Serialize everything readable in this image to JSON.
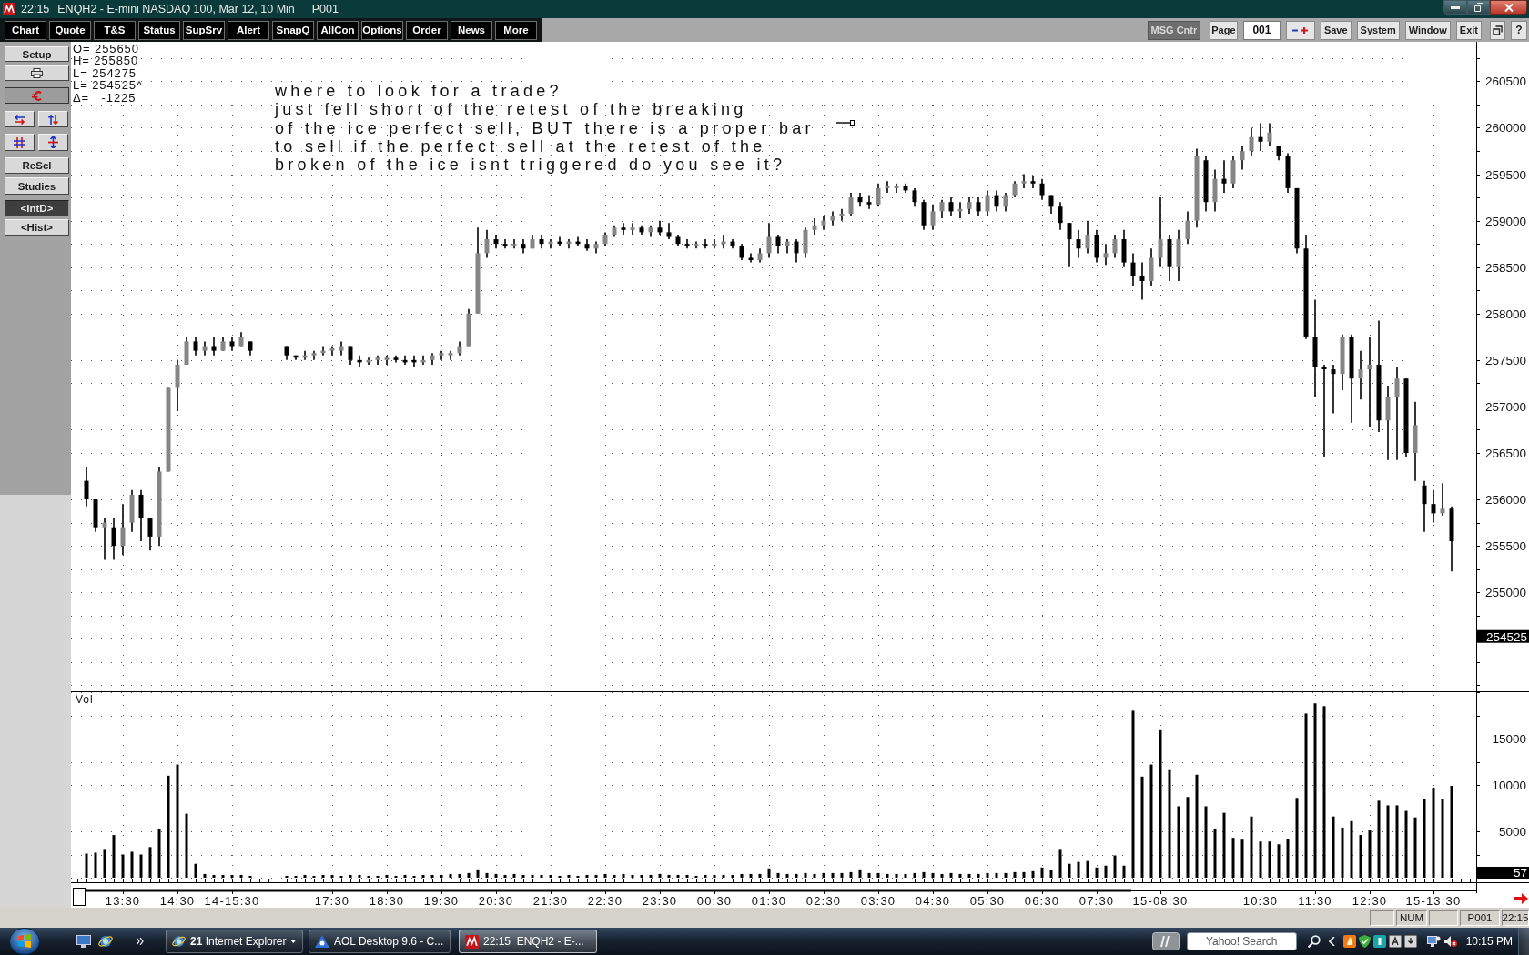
{
  "window": {
    "time": "22:15",
    "title": "ENQH2 - E-mini NASDAQ 100, Mar 12, 10 Min",
    "page": "P001"
  },
  "toolbar": {
    "buttons": [
      "Chart",
      "Quote",
      "T&S",
      "Status",
      "SupSrv",
      "Alert",
      "SnapQ",
      "AllCon",
      "Options",
      "Order",
      "News",
      "More"
    ],
    "message_center": "MSG Cntr",
    "page_label": "Page",
    "page_value": "001",
    "actions": [
      "Save",
      "System",
      "Window",
      "Exit"
    ],
    "help": "?"
  },
  "sidebar": {
    "setup": "Setup",
    "buttons": [
      "ReScl",
      "Studies"
    ],
    "modes": [
      {
        "label": "<IntD>",
        "selected": true
      },
      {
        "label": "<Hist>",
        "selected": false
      }
    ]
  },
  "chart": {
    "readout": [
      "O= 255650",
      "H= 255850",
      "L= 254275",
      "L= 254525^",
      "Δ=   -1225"
    ],
    "note": [
      "where to look for a trade?",
      "just fell short of the retest of the breaking",
      "of the ice perfect sell, BUT there is a proper bar",
      "to sell if the perfect sell at the retest of the",
      "broken of the ice isnt triggered do you see it?"
    ],
    "last_price": "254525",
    "last_volume": "57",
    "chart_data": [
      {
        "type": "candlestick",
        "tick_labels": "y",
        "grid": true,
        "ylim": [
          253925,
          260925
        ],
        "yticks": [
          255000,
          255500,
          256000,
          256500,
          257000,
          257500,
          258000,
          258500,
          259000,
          259500,
          260000,
          260500
        ],
        "ohlc": [
          [
            256200,
            256350,
            255925,
            256000
          ],
          [
            256000,
            256000,
            255650,
            255700
          ],
          [
            255700,
            255800,
            255350,
            255750
          ],
          [
            255700,
            255800,
            255350,
            255500
          ],
          [
            255500,
            255950,
            255400,
            255700
          ],
          [
            255750,
            256100,
            255650,
            256050
          ],
          [
            256050,
            256100,
            255550,
            255800
          ],
          [
            255800,
            255800,
            255450,
            255600
          ],
          [
            255600,
            256350,
            255500,
            256300
          ],
          [
            256300,
            257200,
            256300,
            257200
          ],
          [
            257200,
            257500,
            256950,
            257450
          ],
          [
            257450,
            257750,
            257450,
            257700
          ],
          [
            257700,
            257750,
            257550,
            257600
          ],
          [
            257600,
            257700,
            257550,
            257650
          ],
          [
            257650,
            257750,
            257550,
            257600
          ],
          [
            257600,
            257750,
            257600,
            257700
          ],
          [
            257700,
            257750,
            257600,
            257650
          ],
          [
            257650,
            257800,
            257650,
            257750
          ],
          [
            257700,
            257700,
            257550,
            257600
          ],
          null,
          null,
          null,
          [
            257650,
            257650,
            257500,
            257550
          ],
          [
            257550,
            257550,
            257500,
            257525
          ],
          [
            257525,
            257600,
            257500,
            257550
          ],
          [
            257550,
            257600,
            257500,
            257575
          ],
          [
            257575,
            257650,
            257550,
            257600
          ],
          [
            257600,
            257650,
            257550,
            257625
          ],
          [
            257600,
            257700,
            257550,
            257650
          ],
          [
            257650,
            257650,
            257450,
            257500
          ],
          [
            257500,
            257550,
            257425,
            257475
          ],
          [
            257475,
            257525,
            257450,
            257500
          ],
          [
            257500,
            257550,
            257450,
            257525
          ],
          [
            257500,
            257550,
            257450,
            257525
          ],
          [
            257525,
            257550,
            257475,
            257500
          ],
          [
            257500,
            257550,
            257450,
            257475
          ],
          [
            257500,
            257550,
            257425,
            257475
          ],
          [
            257475,
            257550,
            257450,
            257500
          ],
          [
            257500,
            257575,
            257450,
            257550
          ],
          [
            257550,
            257600,
            257500,
            257575
          ],
          [
            257550,
            257600,
            257500,
            257575
          ],
          [
            257575,
            257700,
            257550,
            257650
          ],
          [
            257650,
            258050,
            257650,
            258000
          ],
          [
            258000,
            258925,
            258000,
            258650
          ],
          [
            258650,
            258900,
            258600,
            258800
          ],
          [
            258800,
            258850,
            258700,
            258750
          ],
          [
            258750,
            258800,
            258700,
            258725
          ],
          [
            258725,
            258800,
            258700,
            258750
          ],
          [
            258750,
            258800,
            258650,
            258700
          ],
          [
            258700,
            258850,
            258700,
            258800
          ],
          [
            258800,
            258850,
            258700,
            258750
          ],
          [
            258750,
            258800,
            258700,
            258775
          ],
          [
            258775,
            258825,
            258725,
            258750
          ],
          [
            258750,
            258800,
            258700,
            258775
          ],
          [
            258775,
            258825,
            258725,
            258750
          ],
          [
            258750,
            258800,
            258675,
            258700
          ],
          [
            258700,
            258775,
            258650,
            258750
          ],
          [
            258750,
            258875,
            258725,
            258850
          ],
          [
            258850,
            258950,
            258825,
            258925
          ],
          [
            258925,
            258975,
            258850,
            258900
          ],
          [
            258900,
            258975,
            258850,
            258925
          ],
          [
            258925,
            258950,
            258850,
            258875
          ],
          [
            258875,
            258950,
            258825,
            258925
          ],
          [
            258925,
            259000,
            258850,
            258875
          ],
          [
            258875,
            258975,
            258800,
            258825
          ],
          [
            258825,
            258850,
            258725,
            258750
          ],
          [
            258750,
            258800,
            258700,
            258725
          ],
          [
            258725,
            258775,
            258700,
            258750
          ],
          [
            258750,
            258800,
            258700,
            258725
          ],
          [
            258725,
            258800,
            258700,
            258750
          ],
          [
            258750,
            258850,
            258700,
            258775
          ],
          [
            258775,
            258800,
            258700,
            258725
          ],
          [
            258725,
            258750,
            258575,
            258600
          ],
          [
            258600,
            258650,
            258550,
            258575
          ],
          [
            258575,
            258700,
            258550,
            258650
          ],
          [
            258650,
            258975,
            258600,
            258825
          ],
          [
            258825,
            258850,
            258650,
            258725
          ],
          [
            258725,
            258800,
            258650,
            258775
          ],
          [
            258775,
            258800,
            258550,
            258650
          ],
          [
            258650,
            258925,
            258600,
            258900
          ],
          [
            258900,
            259025,
            258850,
            258950
          ],
          [
            258950,
            259050,
            258900,
            259000
          ],
          [
            259000,
            259100,
            258950,
            259050
          ],
          [
            259050,
            259125,
            259000,
            259075
          ],
          [
            259075,
            259300,
            259050,
            259250
          ],
          [
            259250,
            259300,
            259150,
            259200
          ],
          [
            259200,
            259275,
            259125,
            259175
          ],
          [
            259175,
            259400,
            259150,
            259350
          ],
          [
            259350,
            259425,
            259300,
            259375
          ],
          [
            259350,
            259400,
            259300,
            259375
          ],
          [
            259375,
            259400,
            259300,
            259325
          ],
          [
            259325,
            259350,
            259150,
            259200
          ],
          [
            259200,
            259225,
            258900,
            258950
          ],
          [
            258950,
            259175,
            258900,
            259100
          ],
          [
            259100,
            259225,
            259025,
            259200
          ],
          [
            259200,
            259250,
            259050,
            259100
          ],
          [
            259100,
            259200,
            259025,
            259125
          ],
          [
            259125,
            259250,
            259075,
            259200
          ],
          [
            259200,
            259250,
            259050,
            259100
          ],
          [
            259100,
            259325,
            259050,
            259275
          ],
          [
            259275,
            259325,
            259100,
            259150
          ],
          [
            259150,
            259300,
            259100,
            259275
          ],
          [
            259275,
            259425,
            259250,
            259400
          ],
          [
            259400,
            259500,
            259350,
            259425
          ],
          [
            259425,
            259475,
            259350,
            259400
          ],
          [
            259400,
            259450,
            259225,
            259275
          ],
          [
            259275,
            259275,
            259075,
            259150
          ],
          [
            259150,
            259200,
            258900,
            258975
          ],
          [
            258975,
            258975,
            258500,
            258800
          ],
          [
            258800,
            258900,
            258600,
            258700
          ],
          [
            258700,
            259000,
            258650,
            258850
          ],
          [
            258850,
            258900,
            258550,
            258600
          ],
          [
            258600,
            258750,
            258525,
            258650
          ],
          [
            258650,
            258850,
            258600,
            258800
          ],
          [
            258800,
            258900,
            258500,
            258550
          ],
          [
            258550,
            258650,
            258300,
            258400
          ],
          [
            258400,
            258550,
            258150,
            258350
          ],
          [
            258350,
            258700,
            258300,
            258600
          ],
          [
            258600,
            259250,
            258500,
            258800
          ],
          [
            258800,
            258850,
            258350,
            258500
          ],
          [
            258500,
            258900,
            258350,
            258800
          ],
          [
            258800,
            259100,
            258750,
            259000
          ],
          [
            259000,
            259775,
            258925,
            259700
          ],
          [
            259650,
            259700,
            259100,
            259200
          ],
          [
            259200,
            259550,
            259100,
            259450
          ],
          [
            259450,
            259650,
            259300,
            259400
          ],
          [
            259400,
            259700,
            259350,
            259650
          ],
          [
            259650,
            259800,
            259550,
            259750
          ],
          [
            259750,
            260000,
            259700,
            259900
          ],
          [
            259900,
            260050,
            259750,
            259850
          ],
          [
            259850,
            260050,
            259800,
            259950
          ],
          [
            259800,
            259800,
            259650,
            259700
          ],
          [
            259700,
            259725,
            259300,
            259350
          ],
          [
            259350,
            259350,
            258650,
            258700
          ],
          [
            258700,
            258850,
            257725,
            257750
          ],
          [
            257750,
            258150,
            257100,
            257425
          ],
          [
            257425,
            257450,
            256450,
            257400
          ],
          [
            257400,
            257450,
            256925,
            257350
          ],
          [
            257350,
            257775,
            257175,
            257750
          ],
          [
            257750,
            257775,
            256825,
            257300
          ],
          [
            257300,
            257600,
            257075,
            257400
          ],
          [
            257400,
            257750,
            256775,
            257450
          ],
          [
            257450,
            257925,
            256725,
            256850
          ],
          [
            256850,
            257225,
            256425,
            257100
          ],
          [
            257100,
            257425,
            256425,
            257300
          ],
          [
            257300,
            257300,
            256450,
            256500
          ],
          [
            256500,
            257050,
            256200,
            256800
          ],
          [
            256150,
            256200,
            255650,
            255950
          ],
          [
            255950,
            256100,
            255750,
            255850
          ],
          [
            255850,
            256175,
            255825,
            255900
          ],
          [
            255900,
            255925,
            255225,
            255550
          ]
        ]
      },
      {
        "type": "bar",
        "title": "Vol",
        "grid": true,
        "ylim": [
          0,
          20000
        ],
        "yticks": [
          5000,
          10000,
          15000
        ],
        "categories": [
          null,
          null,
          null,
          null,
          "13:30",
          null,
          null,
          null,
          null,
          null,
          "14:30",
          null,
          null,
          null,
          null,
          null,
          "14-15:30",
          null,
          null,
          null,
          null,
          null,
          null,
          null,
          null,
          null,
          null,
          "17:30",
          null,
          null,
          null,
          null,
          null,
          "18:30",
          null,
          null,
          null,
          null,
          null,
          "19:30",
          null,
          null,
          null,
          null,
          null,
          "20:30",
          null,
          null,
          null,
          null,
          null,
          "21:30",
          null,
          null,
          null,
          null,
          null,
          "22:30",
          null,
          null,
          null,
          null,
          null,
          "23:30",
          null,
          null,
          null,
          null,
          null,
          "00:30",
          null,
          null,
          null,
          null,
          null,
          "01:30",
          null,
          null,
          null,
          null,
          null,
          "02:30",
          null,
          null,
          null,
          null,
          null,
          "03:30",
          null,
          null,
          null,
          null,
          null,
          "04:30",
          null,
          null,
          null,
          null,
          null,
          "05:30",
          null,
          null,
          null,
          null,
          null,
          "06:30",
          null,
          null,
          null,
          null,
          null,
          "07:30",
          null,
          null,
          null,
          null,
          null,
          null,
          "15-08:30",
          null,
          null,
          null,
          null,
          null,
          null,
          null,
          null,
          null,
          null,
          "10:30",
          null,
          null,
          null,
          null,
          null,
          "11:30",
          null,
          null,
          null,
          null,
          null,
          "12:30",
          null,
          null,
          null,
          null,
          null,
          null,
          "15-13:30",
          null,
          null
        ],
        "values": [
          2600,
          2700,
          3000,
          4600,
          2500,
          2800,
          2500,
          3300,
          5200,
          11000,
          12200,
          6900,
          1500,
          400,
          300,
          300,
          300,
          300,
          200,
          null,
          null,
          null,
          200,
          200,
          300,
          200,
          300,
          300,
          200,
          300,
          300,
          200,
          200,
          300,
          200,
          300,
          200,
          300,
          300,
          300,
          400,
          400,
          500,
          900,
          500,
          400,
          300,
          400,
          300,
          300,
          300,
          300,
          200,
          300,
          200,
          300,
          300,
          400,
          300,
          400,
          300,
          300,
          300,
          400,
          300,
          300,
          300,
          200,
          300,
          300,
          300,
          300,
          400,
          400,
          400,
          1000,
          500,
          400,
          400,
          500,
          400,
          500,
          500,
          500,
          600,
          900,
          500,
          500,
          400,
          400,
          400,
          500,
          600,
          500,
          400,
          500,
          400,
          400,
          400,
          500,
          500,
          500,
          600,
          600,
          700,
          1100,
          800,
          3000,
          1500,
          1700,
          1800,
          1100,
          1300,
          2400,
          1300,
          18000,
          10900,
          12200,
          15900,
          11600,
          7700,
          8700,
          11100,
          7700,
          5300,
          7000,
          4300,
          4100,
          6600,
          3900,
          3900,
          3600,
          4200,
          8600,
          17700,
          18800,
          18500,
          6600,
          5400,
          6100,
          4600,
          5100,
          8300,
          7800,
          7800,
          7200,
          6500,
          8500,
          9700,
          8500,
          9900
        ]
      }
    ]
  },
  "status_bar": {
    "cells": [
      "NUM",
      "P001",
      "22:15"
    ]
  },
  "taskbar": {
    "tasks": [
      {
        "count": "21",
        "label": "Internet Explorer",
        "selected": false
      },
      {
        "label": "AOL Desktop 9.6 - C...",
        "selected": false
      },
      {
        "label": "22:15  ENQH2 - E-...",
        "selected": true
      }
    ],
    "search": {
      "placeholder": "Yahoo! Search"
    },
    "clock": "10:15 PM"
  }
}
